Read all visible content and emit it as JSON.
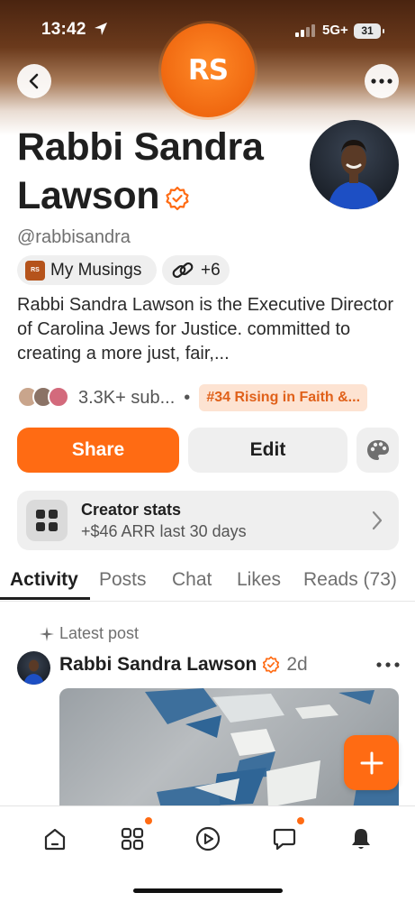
{
  "status_bar": {
    "time": "13:42",
    "network": "5G+",
    "battery": "31"
  },
  "header": {
    "logo_text": "RS"
  },
  "profile": {
    "name": "Rabbi Sandra Lawson",
    "handle": "@rabbisandra",
    "publication_chip": "My Musings",
    "links_chip": "+6",
    "bio": "Rabbi Sandra Lawson is the Executive Director of Carolina Jews for Justice. committed to creating a more just, fair,...",
    "subscribers": "3.3K+ sub...",
    "separator": "•",
    "rank_badge": "#34 Rising in Faith &..."
  },
  "actions": {
    "share_label": "Share",
    "edit_label": "Edit"
  },
  "creator_stats": {
    "title": "Creator stats",
    "subtitle": "+$46 ARR last 30 days"
  },
  "tabs": [
    {
      "label": "Activity",
      "active": true
    },
    {
      "label": "Posts",
      "active": false
    },
    {
      "label": "Chat",
      "active": false
    },
    {
      "label": "Likes",
      "active": false
    },
    {
      "label": "Reads (73)",
      "active": false
    }
  ],
  "feed": {
    "latest_label": "Latest post",
    "author": "Rabbi Sandra Lawson",
    "time": "2d"
  },
  "bottom_nav": {
    "items": [
      "home-icon",
      "grid-icon",
      "play-icon",
      "chat-icon",
      "bell-icon"
    ]
  },
  "colors": {
    "accent": "#ff6b13",
    "badge_bg": "#fde3d2",
    "badge_text": "#e0611a"
  }
}
